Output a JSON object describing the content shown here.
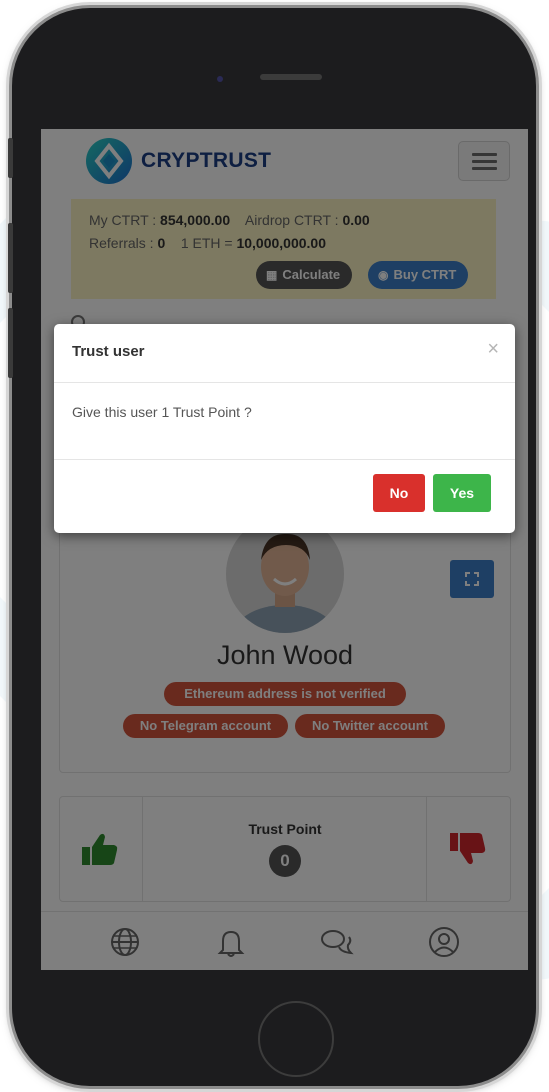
{
  "header": {
    "logo_text": "CRYPTRUST"
  },
  "wallet": {
    "my_ctrt_label": "My CTRT : ",
    "my_ctrt_value": "854,000.00",
    "airdrop_label": "Airdrop CTRT : ",
    "airdrop_value": "0.00",
    "referrals_label": "Referrals : ",
    "referrals_value": "0",
    "eth_rate_label": "1 ETH = ",
    "eth_rate_value": "10,000,000.00",
    "calculate_label": "Calculate",
    "buy_label": "Buy CTRT"
  },
  "profile": {
    "name": "John Wood",
    "badges": [
      "Ethereum address is not verified",
      "No Telegram account",
      "No Twitter account"
    ]
  },
  "trust": {
    "label": "Trust Point",
    "count": "0"
  },
  "modal": {
    "title": "Trust user",
    "close_glyph": "×",
    "message": "Give this user 1 Trust Point ?",
    "no_label": "No",
    "yes_label": "Yes"
  },
  "tabbar": {
    "icons": [
      "globe-icon",
      "bell-icon",
      "chat-icon",
      "user-icon"
    ]
  },
  "colors": {
    "brand_blue": "#1d3f84",
    "wallet_bg": "#fbf3c3",
    "calculate_btn": "#555555",
    "buy_btn": "#3c7fc9",
    "badge_red": "#d2553d",
    "no_btn": "#d9302c",
    "yes_btn": "#3db54a",
    "thumb_up": "#2f8a2f",
    "thumb_down": "#d0262d"
  }
}
